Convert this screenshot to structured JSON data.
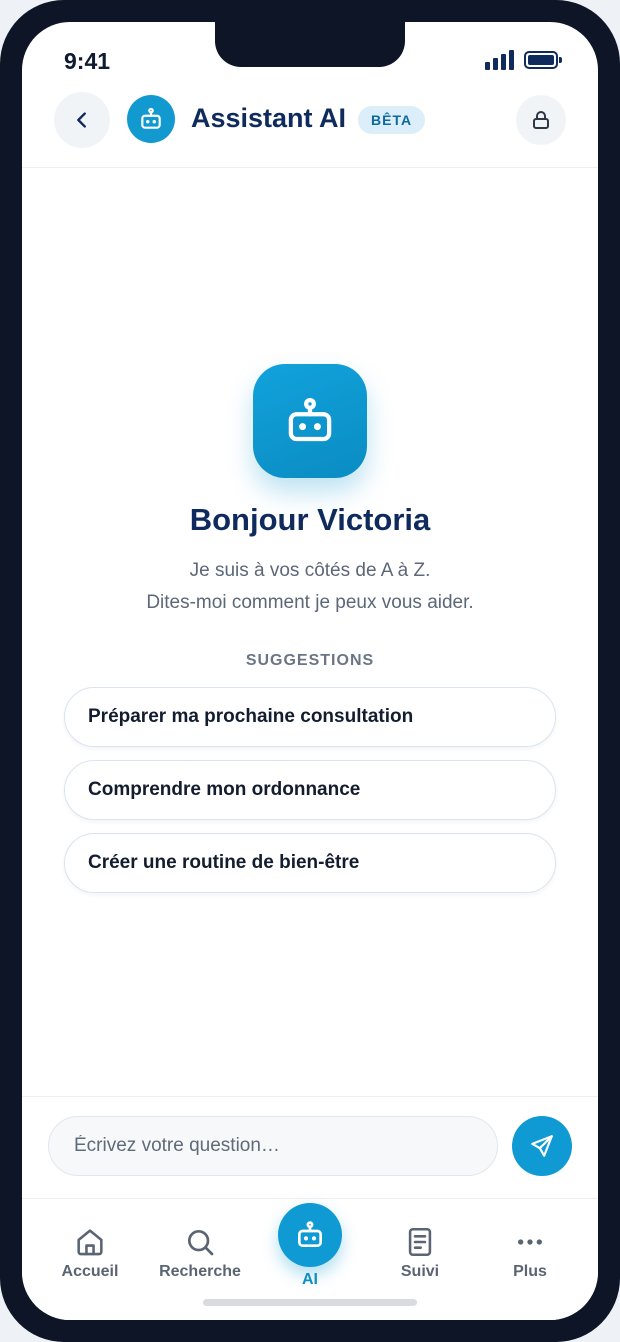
{
  "status_bar": {
    "time": "9:41"
  },
  "header": {
    "title": "Assistant AI",
    "badge": "BÊTA"
  },
  "welcome": {
    "greeting": "Bonjour Victoria",
    "line1": "Je suis à vos côtés de A à Z.",
    "line2": "Dites-moi comment je peux vous aider."
  },
  "suggestions": {
    "heading": "SUGGESTIONS",
    "items": [
      "Préparer ma prochaine consultation",
      "Comprendre mon ordonnance",
      "Créer une routine de bien-être"
    ]
  },
  "composer": {
    "placeholder": "Écrivez votre question…"
  },
  "tabs": [
    {
      "label": "Accueil",
      "icon": "home-icon"
    },
    {
      "label": "Recherche",
      "icon": "search-icon"
    },
    {
      "label": "AI",
      "icon": "robot-icon",
      "active": true
    },
    {
      "label": "Suivi",
      "icon": "document-icon"
    },
    {
      "label": "Plus",
      "icon": "more-icon"
    }
  ],
  "colors": {
    "accent": "#0f9ad4",
    "navy": "#0f2a5c",
    "badge_bg": "#dceef9"
  }
}
